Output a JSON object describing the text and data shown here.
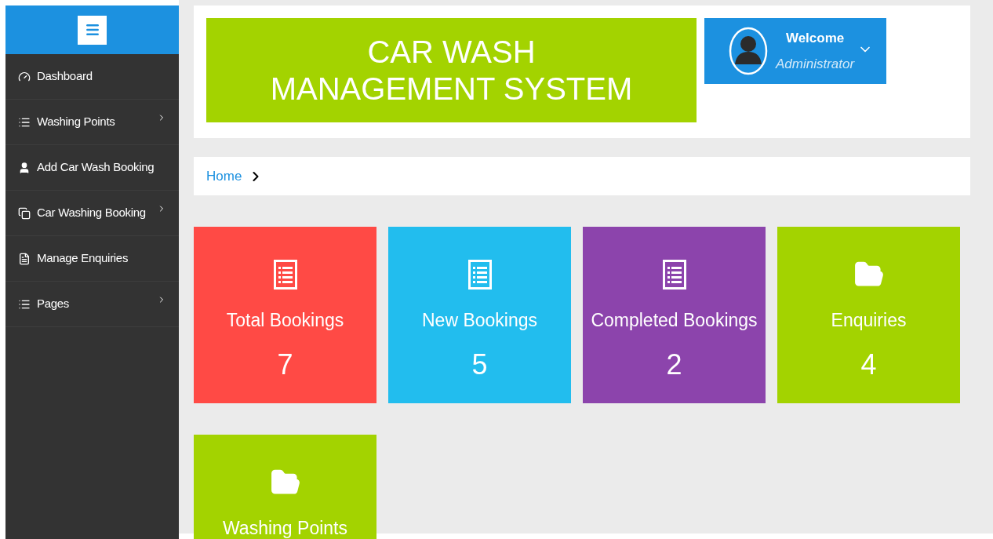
{
  "sidebar": {
    "items": [
      {
        "label": "Dashboard",
        "expandable": false
      },
      {
        "label": "Washing Points",
        "expandable": true
      },
      {
        "label": "Add Car Wash Booking",
        "expandable": false
      },
      {
        "label": "Car Washing Booking",
        "expandable": true
      },
      {
        "label": "Manage Enquiries",
        "expandable": false
      },
      {
        "label": "Pages",
        "expandable": true
      }
    ]
  },
  "header": {
    "title": "CAR WASH MANAGEMENT SYSTEM",
    "user": {
      "greeting": "Welcome",
      "role": "Administrator"
    }
  },
  "breadcrumb": [
    "Home"
  ],
  "cards": [
    {
      "label": "Total Bookings",
      "value": "7",
      "color": "#ff4a45"
    },
    {
      "label": "New Bookings",
      "value": "5",
      "color": "#22bdee"
    },
    {
      "label": "Completed Bookings",
      "value": "2",
      "color": "#8c44ac"
    },
    {
      "label": "Enquiries",
      "value": "4",
      "color": "#a3d300"
    },
    {
      "label": "Washing Points",
      "color": "#a3d300"
    }
  ]
}
